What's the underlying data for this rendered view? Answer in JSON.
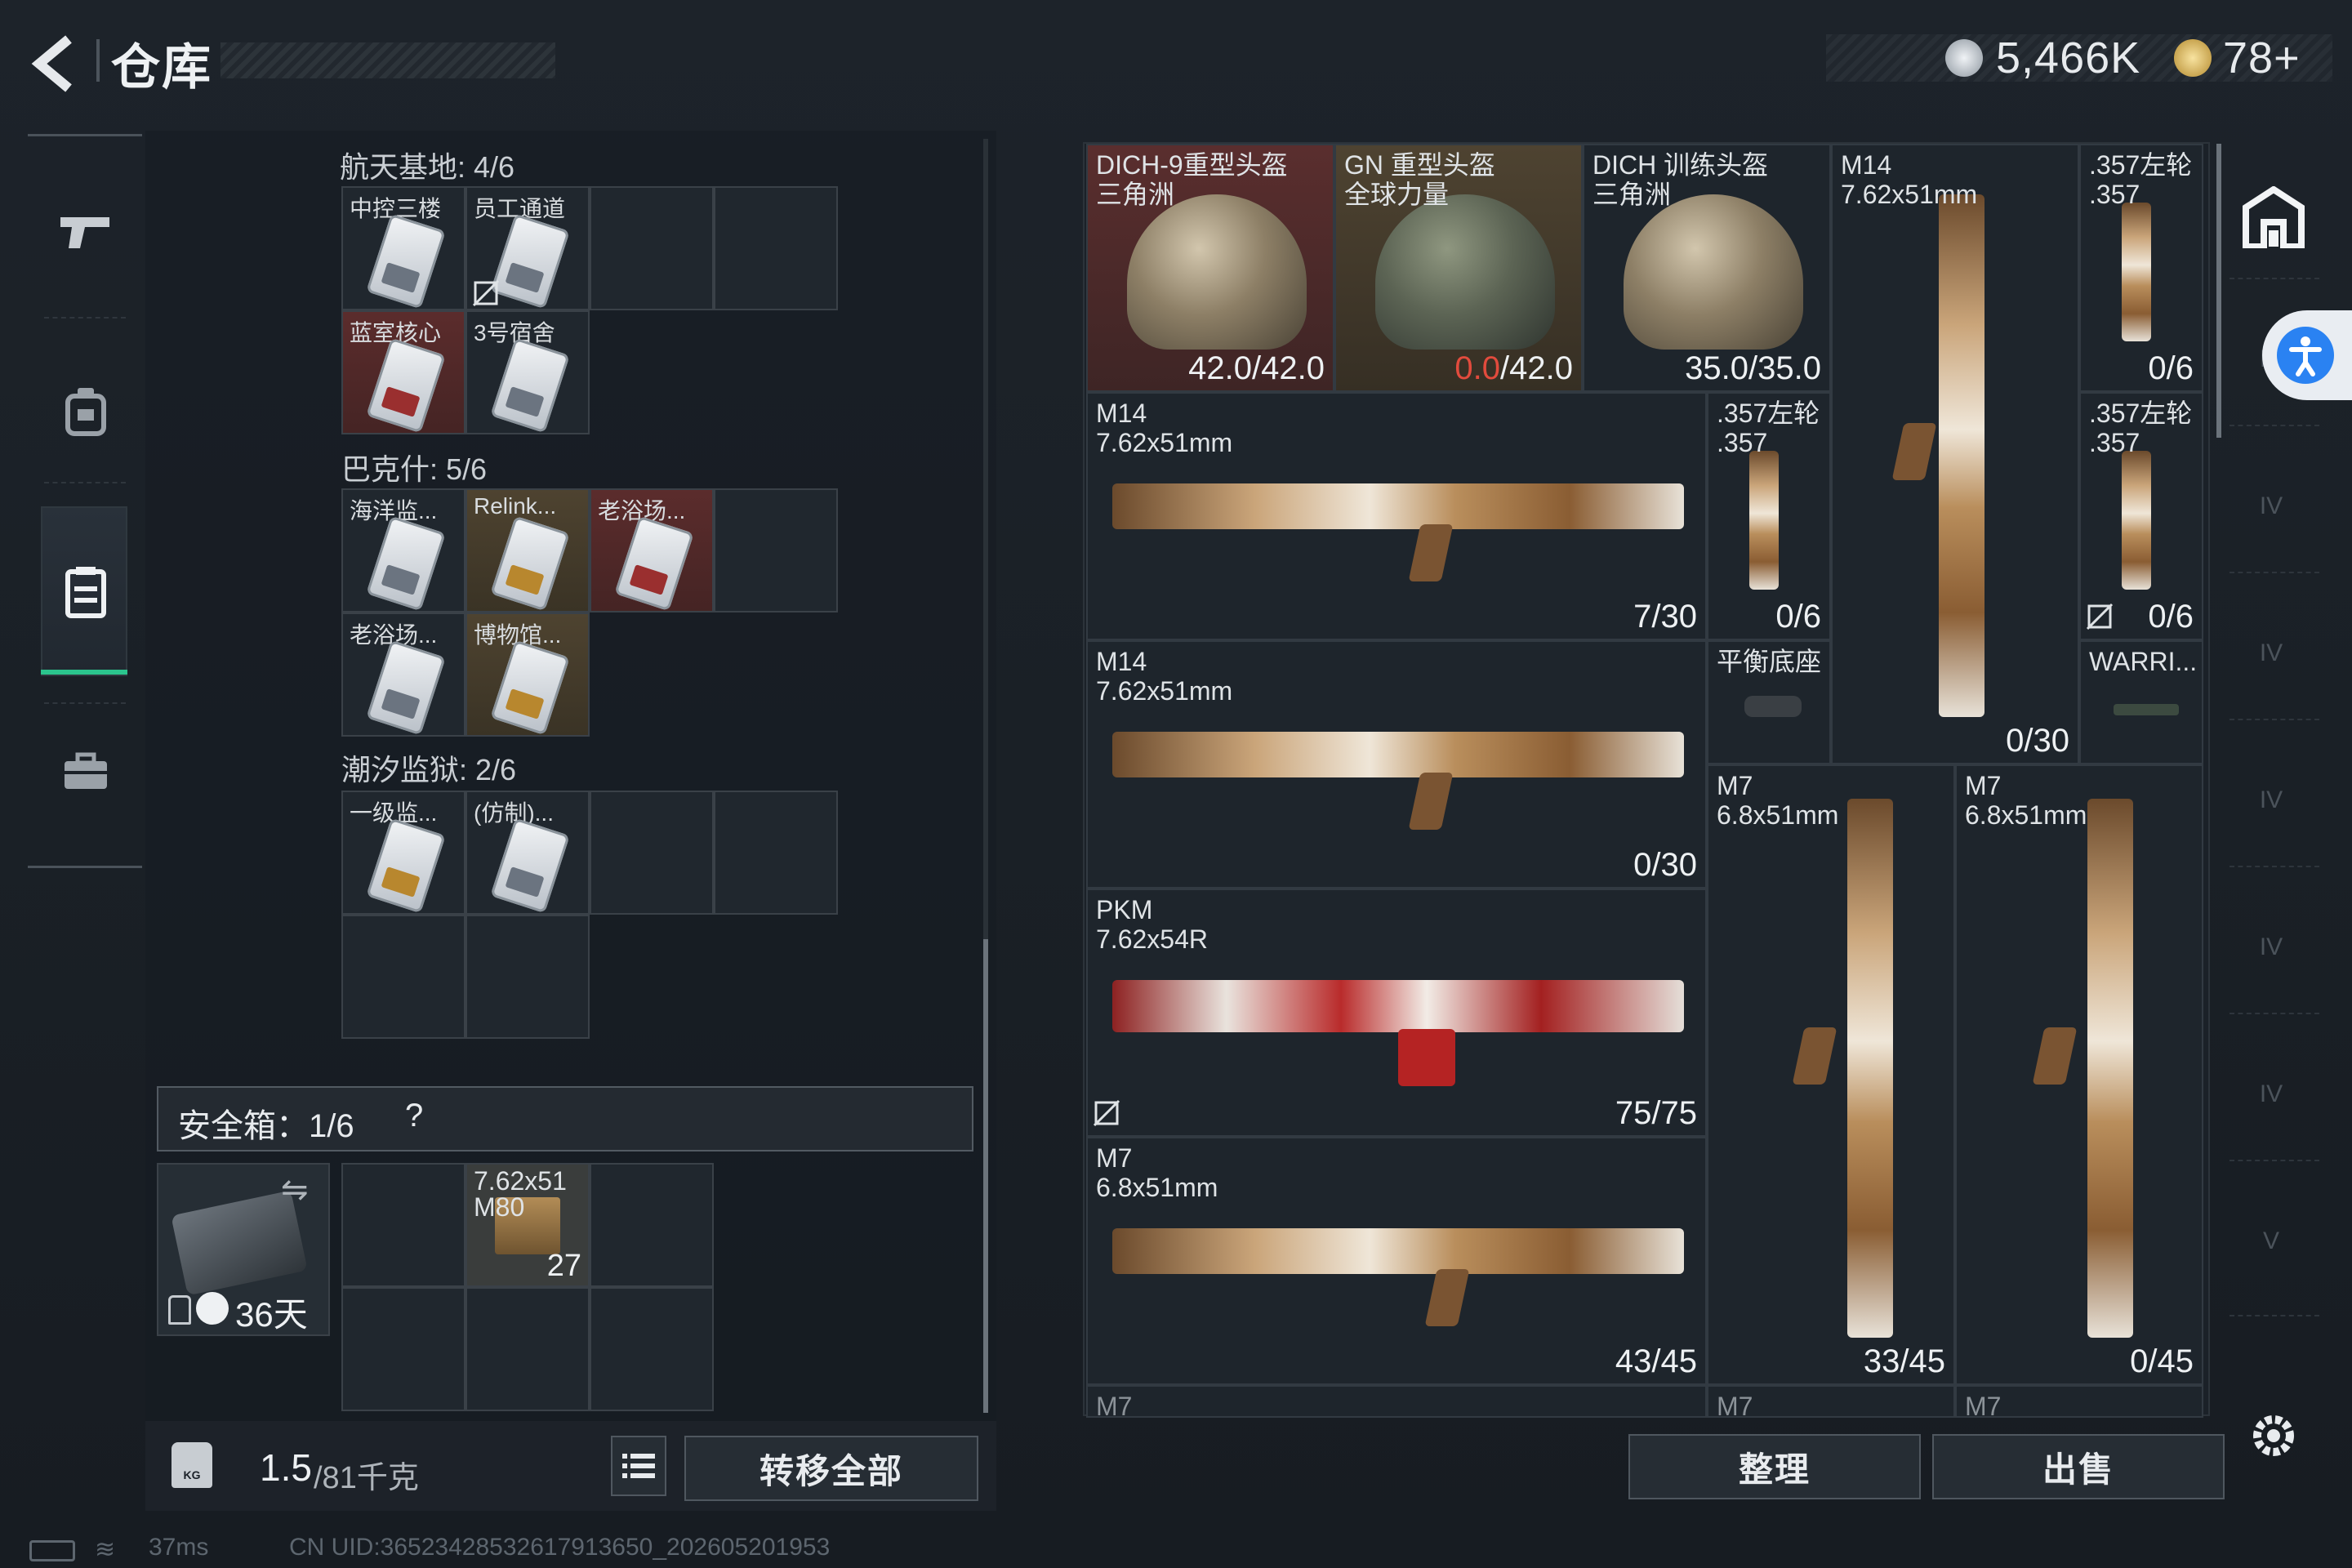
{
  "header": {
    "title": "仓库",
    "money": "5,466K",
    "tokens": "78+"
  },
  "left_nav": {
    "icons": [
      "pistol-icon",
      "backpack-icon",
      "chest-rig-icon",
      "briefcase-icon"
    ],
    "selected": "chest-rig-icon"
  },
  "containers": {
    "sections": [
      {
        "name": "航天基地: 4/6",
        "cells": [
          {
            "label": "中控三楼",
            "tint": "none"
          },
          {
            "label": "员工通道",
            "tint": "none",
            "flag": true
          },
          {
            "label": "蓝室核心",
            "tint": "red"
          },
          {
            "label": "3号宿舍",
            "tint": "none"
          }
        ]
      },
      {
        "name": "巴克什: 5/6",
        "cells": [
          {
            "label": "海洋监...",
            "tint": "none"
          },
          {
            "label": "Relink...",
            "tint": "gold"
          },
          {
            "label": "老浴场...",
            "tint": "red"
          },
          {
            "label": "老浴场...",
            "tint": "none"
          },
          {
            "label": "博物馆...",
            "tint": "gold"
          }
        ]
      },
      {
        "name": "潮汐监狱: 2/6",
        "cells": [
          {
            "label": "一级监...",
            "tint": "none"
          },
          {
            "label": "(仿制)...",
            "tint": "none"
          }
        ]
      }
    ]
  },
  "safe_box": {
    "label": "安全箱：1/6",
    "help": "?",
    "timer": "36天",
    "ammo_name": "7.62x51\nM80",
    "ammo_count": "27"
  },
  "weight": {
    "current": "1.5",
    "max": "/81千克",
    "kg_icon": "KG"
  },
  "buttons": {
    "transfer_all": "转移全部",
    "sort": "整理",
    "sell": "出售"
  },
  "stash": {
    "items": [
      {
        "id": "dich9",
        "name": "DICH-9重型头盔\n三角洲",
        "count": "42.0/42.0",
        "tint": "red"
      },
      {
        "id": "gn",
        "name": "GN 重型头盔\n全球力量",
        "count_red": "0.0",
        "count_rest": "/42.0",
        "tint": "gold"
      },
      {
        "id": "dich_train",
        "name": "DICH 训练头盔\n三角洲",
        "count": "35.0/35.0",
        "tint": "none"
      },
      {
        "id": "m14_v",
        "name": "M14\n7.62x51mm",
        "count": "0/30",
        "tint": "none"
      },
      {
        "id": "r357_a",
        "name": ".357左轮\n.357",
        "count": "0/6",
        "tint": "none"
      },
      {
        "id": "m14_a",
        "name": "M14\n7.62x51mm",
        "count": "7/30",
        "tint": "none"
      },
      {
        "id": "r357_b",
        "name": ".357左轮\n.357",
        "count": "0/6",
        "tint": "none"
      },
      {
        "id": "r357_c",
        "name": ".357左轮\n.357",
        "count": "0/6",
        "tint": "none"
      },
      {
        "id": "m14_b",
        "name": "M14\n7.62x51mm",
        "count": "0/30",
        "tint": "none"
      },
      {
        "id": "base",
        "name": "平衡底座",
        "count": "",
        "tint": "none"
      },
      {
        "id": "warri",
        "name": "WARRI...",
        "count": "",
        "tint": "none"
      },
      {
        "id": "m7_v1",
        "name": "M7\n6.8x51mm",
        "count": "33/45",
        "tint": "none"
      },
      {
        "id": "m7_v2",
        "name": "M7\n6.8x51mm",
        "count": "0/45",
        "tint": "none"
      },
      {
        "id": "pkm",
        "name": "PKM\n7.62x54R",
        "count": "75/75",
        "tint": "none"
      },
      {
        "id": "m7_h",
        "name": "M7\n6.8x51mm",
        "count": "43/45",
        "tint": "none"
      },
      {
        "id": "m7_c1",
        "name": "M7",
        "count": "",
        "tint": "none"
      },
      {
        "id": "m7_c2",
        "name": "M7",
        "count": "",
        "tint": "none"
      },
      {
        "id": "m7_c3",
        "name": "M7",
        "count": "",
        "tint": "none"
      }
    ]
  },
  "right_nav": {
    "labels": [
      "IV",
      "IV",
      "IV",
      "IV",
      "IV",
      "IV",
      "V"
    ]
  },
  "status": {
    "ping": "37ms",
    "uid": "CN UID:36523428532617913650_202605201953"
  }
}
